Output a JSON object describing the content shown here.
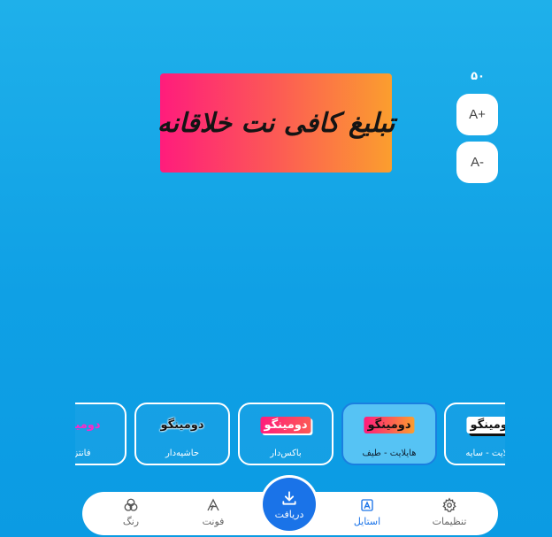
{
  "preview": {
    "text": "تبلیغ کافی نت خلاقانه",
    "colors": {
      "gradient_start": "#ff1c7c",
      "gradient_end": "#fb9e2e"
    }
  },
  "font_size": {
    "value": "۵۰",
    "increase_label": "A+",
    "decrease_label": "A-"
  },
  "styles": [
    {
      "sample": "دومینگو",
      "label": "فانتزی",
      "variant": "fancy"
    },
    {
      "sample": "دومینگو",
      "label": "حاشیه‌دار",
      "variant": "outline"
    },
    {
      "sample": "دومینگو",
      "label": "باکس‌دار",
      "variant": "boxed"
    },
    {
      "sample": "دومینگو",
      "label": "هایلایت - طیف",
      "variant": "highlight",
      "selected": true
    },
    {
      "sample": "دومینگو",
      "label": "هایلایت - سایه",
      "variant": "shadow"
    }
  ],
  "nav": {
    "color": "رنگ",
    "font": "فونت",
    "download": "دریافت",
    "style": "استایل",
    "settings": "تنظیمات"
  },
  "accent_color": "#1a73e8"
}
